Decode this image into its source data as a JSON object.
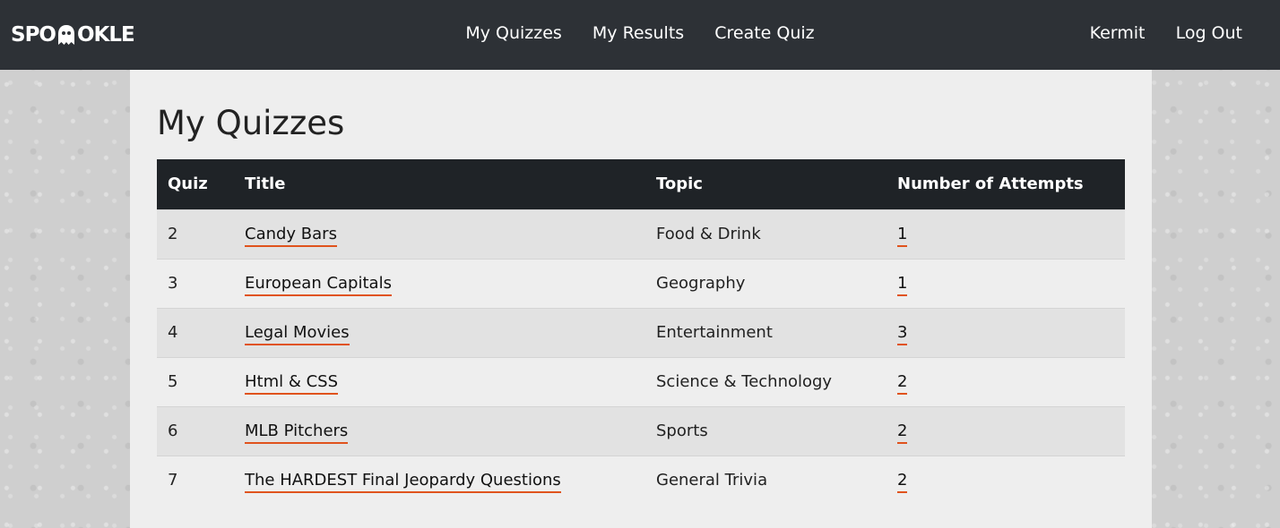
{
  "brand": {
    "left": "SPO",
    "right": "OKLE"
  },
  "nav": {
    "center": [
      "My Quizzes",
      "My Results",
      "Create Quiz"
    ],
    "user": "Kermit",
    "logout": "Log Out"
  },
  "page": {
    "title": "My Quizzes"
  },
  "table": {
    "headers": [
      "Quiz",
      "Title",
      "Topic",
      "Number of Attempts"
    ],
    "rows": [
      {
        "quiz": "2",
        "title": "Candy Bars",
        "topic": "Food & Drink",
        "attempts": "1"
      },
      {
        "quiz": "3",
        "title": "European Capitals",
        "topic": "Geography",
        "attempts": "1"
      },
      {
        "quiz": "4",
        "title": "Legal Movies",
        "topic": "Entertainment",
        "attempts": "3"
      },
      {
        "quiz": "5",
        "title": "Html & CSS",
        "topic": "Science & Technology",
        "attempts": "2"
      },
      {
        "quiz": "6",
        "title": "MLB Pitchers",
        "topic": "Sports",
        "attempts": "2"
      },
      {
        "quiz": "7",
        "title": "The HARDEST Final Jeopardy Questions",
        "topic": "General Trivia",
        "attempts": "2"
      }
    ]
  },
  "colors": {
    "navbar": "#2d3136",
    "link_underline": "#e0531d",
    "table_header": "#1f2327"
  }
}
